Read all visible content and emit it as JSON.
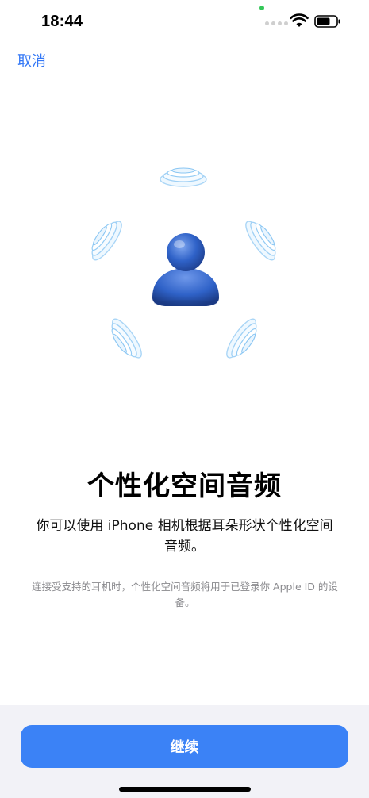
{
  "status_bar": {
    "time": "18:44",
    "privacy_indicator_color": "#34c759",
    "icons": [
      "signal-dots-icon",
      "wifi-icon",
      "battery-icon"
    ]
  },
  "nav": {
    "cancel_label": "取消"
  },
  "content": {
    "title": "个性化空间音频",
    "description": "你可以使用 iPhone 相机根据耳朵形状个性化空间音频。",
    "footnote": "连接受支持的耳机时，个性化空间音频将用于已登录你 Apple ID 的设备。",
    "hero_icons": [
      "person-icon",
      "sound-wave-icon"
    ]
  },
  "footer": {
    "continue_label": "继续"
  },
  "colors": {
    "accent": "#3478f6",
    "button": "#3b82f6",
    "person": "#2f62c8",
    "waves": "#bfe2fb",
    "bottom_bar": "#f2f2f7",
    "privacy_dot": "#34c759"
  }
}
